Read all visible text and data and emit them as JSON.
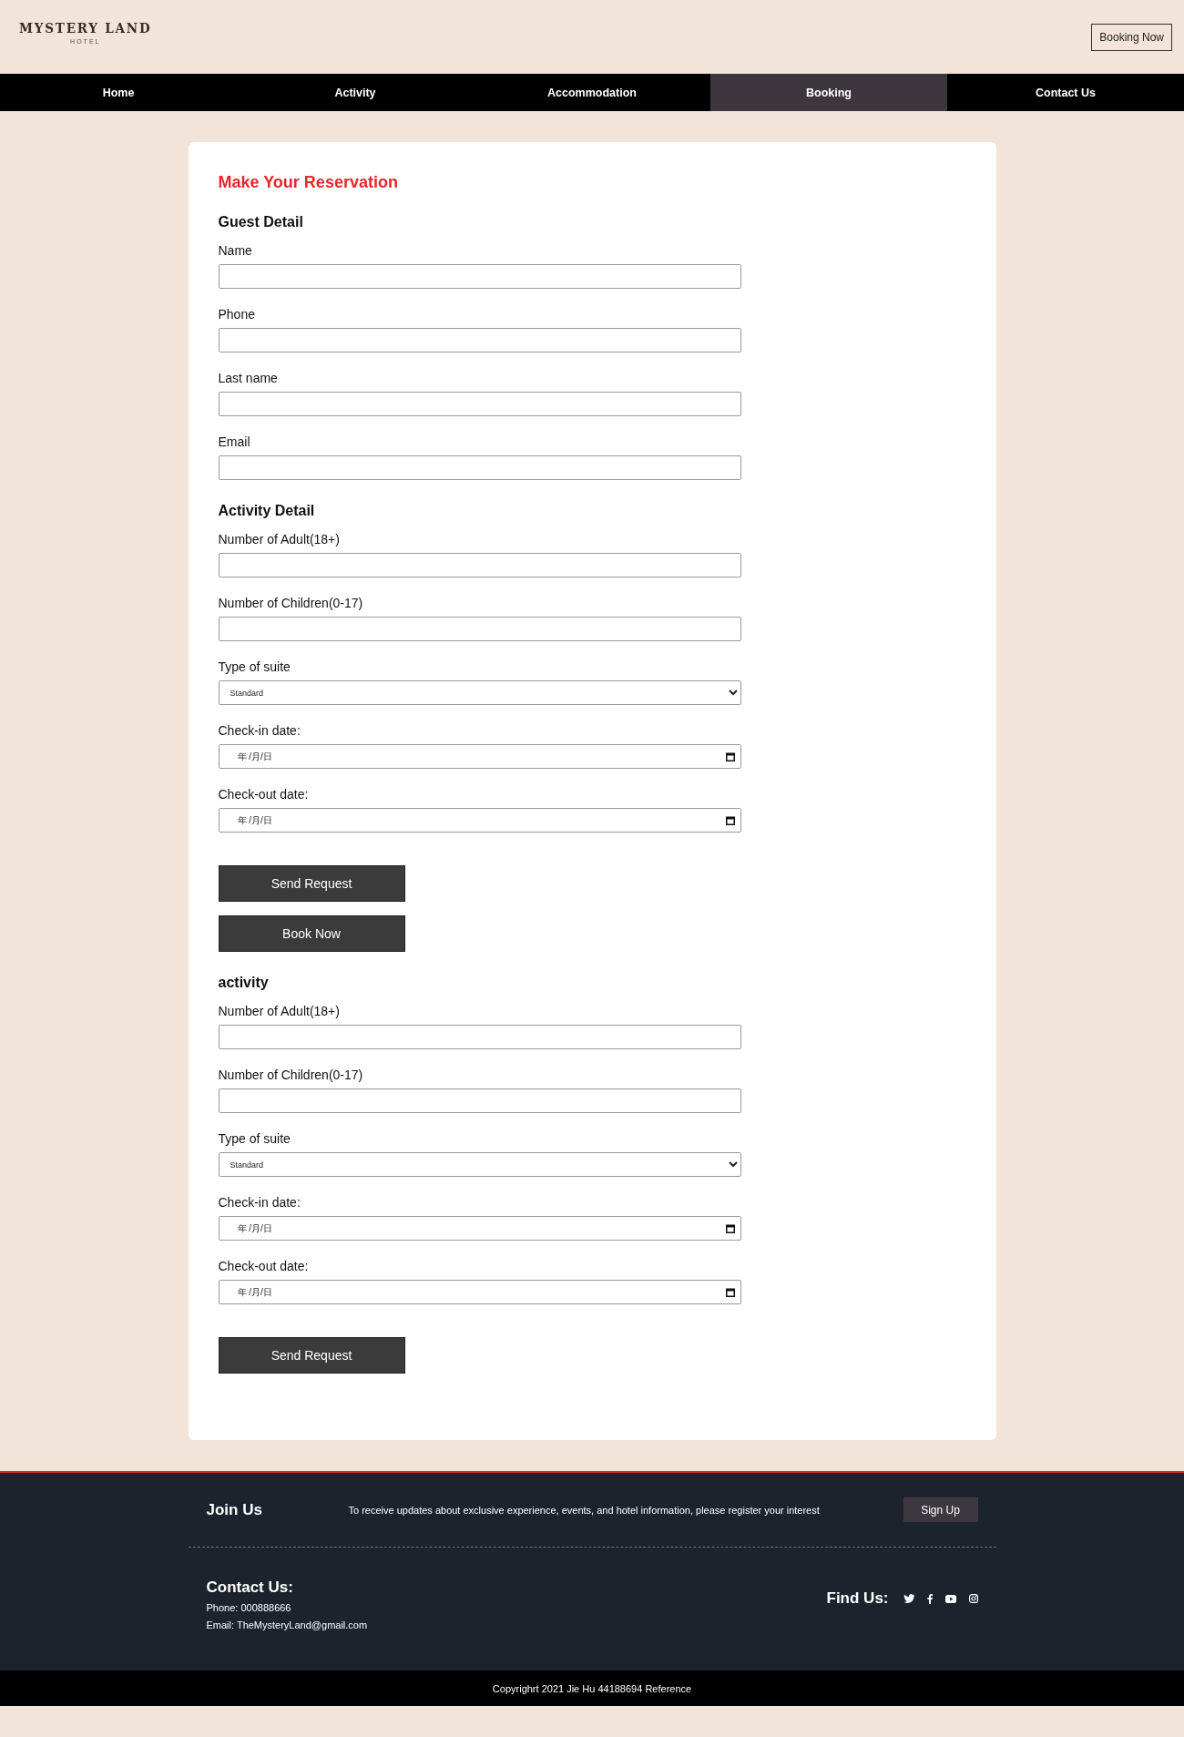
{
  "header": {
    "logo": {
      "name": "MYSTERY LAND",
      "subtitle": "HOTEL"
    },
    "booking_button": "Booking Now"
  },
  "nav": {
    "items": [
      {
        "label": "Home",
        "selected": false
      },
      {
        "label": "Activity",
        "selected": false
      },
      {
        "label": "Accommodation",
        "selected": false
      },
      {
        "label": "Booking",
        "selected": true
      },
      {
        "label": "Contact Us",
        "selected": false
      }
    ]
  },
  "form": {
    "title": "Make Your Reservation",
    "sections": [
      {
        "heading": "Guest Detail",
        "fields": [
          {
            "kind": "text",
            "label": "Name"
          },
          {
            "kind": "text",
            "label": "Phone"
          },
          {
            "kind": "text",
            "label": "Last name"
          },
          {
            "kind": "text",
            "label": "Email"
          }
        ]
      },
      {
        "heading": "Activity Detail",
        "fields": [
          {
            "kind": "text",
            "label": "Number of Adult(18+)"
          },
          {
            "kind": "text",
            "label": "Number of Children(0-17)"
          },
          {
            "kind": "select",
            "label": "Type of suite",
            "value": "Standard"
          },
          {
            "kind": "date",
            "label": "Check-in date:",
            "value": "年 /月/日"
          },
          {
            "kind": "date",
            "label": "Check-out date:",
            "value": "年 /月/日"
          }
        ],
        "buttons": [
          "Send Request",
          "Book Now"
        ]
      },
      {
        "heading": "activity",
        "fields": [
          {
            "kind": "text",
            "label": "Number of Adult(18+)"
          },
          {
            "kind": "text",
            "label": "Number of Children(0-17)"
          },
          {
            "kind": "select",
            "label": "Type of suite",
            "value": "Standard"
          },
          {
            "kind": "date",
            "label": "Check-in date:",
            "value": "年 /月/日"
          },
          {
            "kind": "date",
            "label": "Check-out date:",
            "value": "年 /月/日"
          }
        ],
        "buttons": [
          "Send Request"
        ]
      }
    ]
  },
  "footer": {
    "join": {
      "title": "Join Us",
      "text": "To receive updates about exclusive experience, events, and hotel information, please register your interest",
      "button": "Sign Up"
    },
    "contact": {
      "title": "Contact Us:",
      "phone": "Phone: 000888666",
      "email": "Email: TheMysteryLand@gmail.com"
    },
    "find_us": {
      "title": "Find Us:"
    },
    "copyright": "Copyrighrt 2021 Jie Hu 44188694 Reference"
  }
}
